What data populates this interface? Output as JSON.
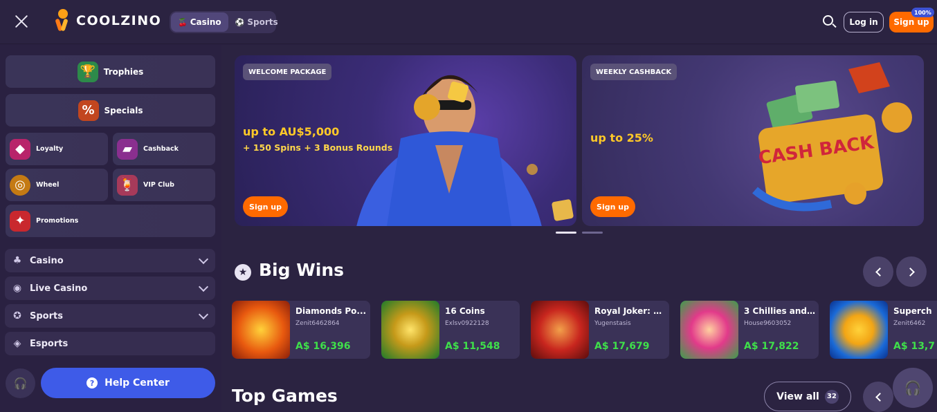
{
  "header": {
    "brand": "COOLZINO",
    "tabs": [
      {
        "label": "Casino",
        "icon": "cherry-icon",
        "active": true
      },
      {
        "label": "Sports",
        "icon": "soccer-ball-icon",
        "active": false
      }
    ],
    "login_label": "Log in",
    "signup_label": "Sign up",
    "signup_badge": "100%"
  },
  "sidebar": {
    "trophies": "Trophies",
    "specials": "Specials",
    "loyalty": "Loyalty",
    "cashback": "Cashback",
    "wheel": "Wheel",
    "vip": "VIP Club",
    "promotions": "Promotions",
    "nav": [
      {
        "label": "Casino",
        "icon": "cherry-icon",
        "expandable": true
      },
      {
        "label": "Live Casino",
        "icon": "broadcast-icon",
        "expandable": true
      },
      {
        "label": "Sports",
        "icon": "soccer-ball-icon",
        "expandable": true
      },
      {
        "label": "Esports",
        "icon": "gamepad-icon",
        "expandable": false
      }
    ],
    "help_label": "Help Center"
  },
  "banners": [
    {
      "tag": "WELCOME PACKAGE",
      "headline": "up to AU$5,000",
      "sub": "+ 150 Spins + 3 Bonus Rounds",
      "button": "Sign up"
    },
    {
      "tag": "WEEKLY CASHBACK",
      "headline": "up to 25%",
      "sub": "",
      "button": "Sign up",
      "art_text": "CASH BACK"
    }
  ],
  "big_wins": {
    "title": "Big Wins",
    "items": [
      {
        "game": "Diamonds Po...",
        "user": "Zenit6462864",
        "amount": "A$ 16,396"
      },
      {
        "game": "16 Coins",
        "user": "Exlsv0922128",
        "amount": "A$ 11,548"
      },
      {
        "game": "Royal Joker: H...",
        "user": "Yugenstasis",
        "amount": "A$ 17,679"
      },
      {
        "game": "3 Chillies and ...",
        "user": "House9603052",
        "amount": "A$ 17,822"
      },
      {
        "game": "Superch",
        "user": "Zenit6462",
        "amount": "A$ 13,7"
      }
    ]
  },
  "top_games": {
    "title": "Top Games",
    "view_all": "View all",
    "count": "32"
  },
  "colors": {
    "accent": "#ff6a00",
    "win_green": "#3fe04a",
    "help_blue": "#3e5be8"
  }
}
